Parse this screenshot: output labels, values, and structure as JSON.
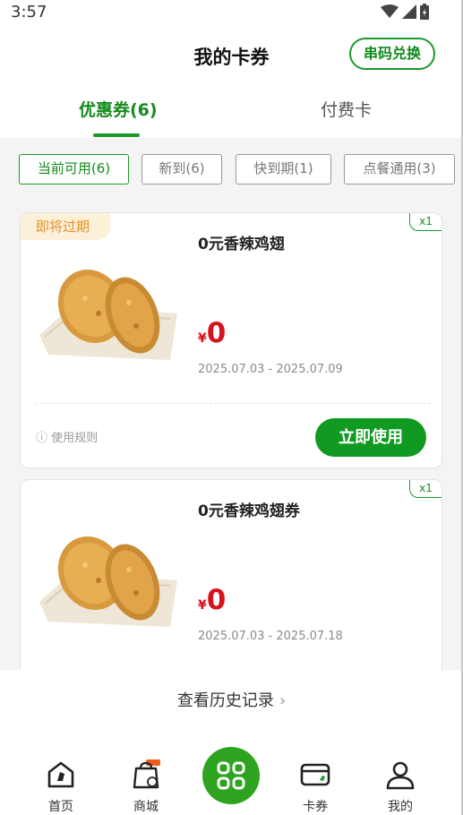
{
  "status": {
    "time": "3:57"
  },
  "header": {
    "title": "我的卡券",
    "redeem_label": "串码兑换"
  },
  "tabs": [
    {
      "label": "优惠券(6)",
      "active": true
    },
    {
      "label": "付费卡",
      "active": false
    }
  ],
  "filters": [
    {
      "label": "当前可用(6)",
      "active": true
    },
    {
      "label": "新到(6)",
      "active": false
    },
    {
      "label": "快到期(1)",
      "active": false
    },
    {
      "label": "点餐通用(3)",
      "active": false
    }
  ],
  "coupons": [
    {
      "tag": "即将过期",
      "qty": "x1",
      "title": "0元香辣鸡翅",
      "currency": "¥",
      "price": "0",
      "dates": "2025.07.03 - 2025.07.09",
      "rules_label": "ⓘ 使用规则",
      "use_label": "立即使用"
    },
    {
      "qty": "x1",
      "title": "0元香辣鸡翅券",
      "currency": "¥",
      "price": "0",
      "dates": "2025.07.03 - 2025.07.18"
    }
  ],
  "history": {
    "label": "查看历史记录",
    "chevron": "›"
  },
  "nav": [
    {
      "label": "首页",
      "icon": "home-icon"
    },
    {
      "label": "商城",
      "icon": "shop-bag-icon"
    },
    {
      "label": "",
      "icon": "qr-scan-icon"
    },
    {
      "label": "卡券",
      "icon": "card-icon"
    },
    {
      "label": "我的",
      "icon": "profile-icon"
    }
  ],
  "colors": {
    "brand_green": "#1a9a2a",
    "price_red": "#d8121d",
    "expiring_orange": "#e0902a"
  }
}
